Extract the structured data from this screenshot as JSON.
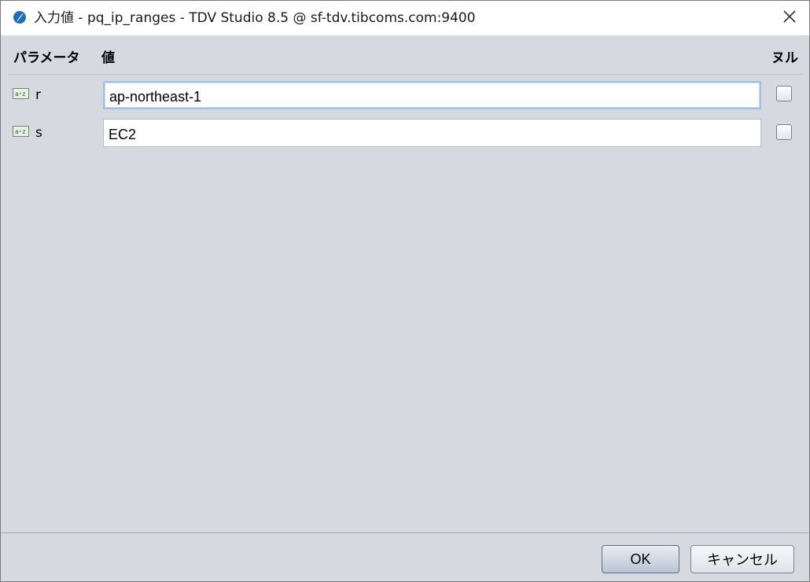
{
  "window": {
    "title": "入力値 - pq_ip_ranges - TDV Studio 8.5 @ sf-tdv.tibcoms.com:9400",
    "app_icon": "tdv-feather-icon",
    "close_icon": "close-x-icon",
    "accent_color": "#1f6fb8"
  },
  "table": {
    "headers": {
      "parameter": "パラメータ",
      "value": "値",
      "null": "ヌル"
    },
    "rows": [
      {
        "name": "r",
        "icon": "string-type-icon",
        "value": "ap-northeast-1",
        "null_checked": false,
        "focused": true
      },
      {
        "name": "s",
        "icon": "string-type-icon",
        "value": "EC2",
        "null_checked": false,
        "focused": false
      }
    ]
  },
  "buttons": {
    "ok_label": "OK",
    "cancel_label": "キャンセル"
  }
}
